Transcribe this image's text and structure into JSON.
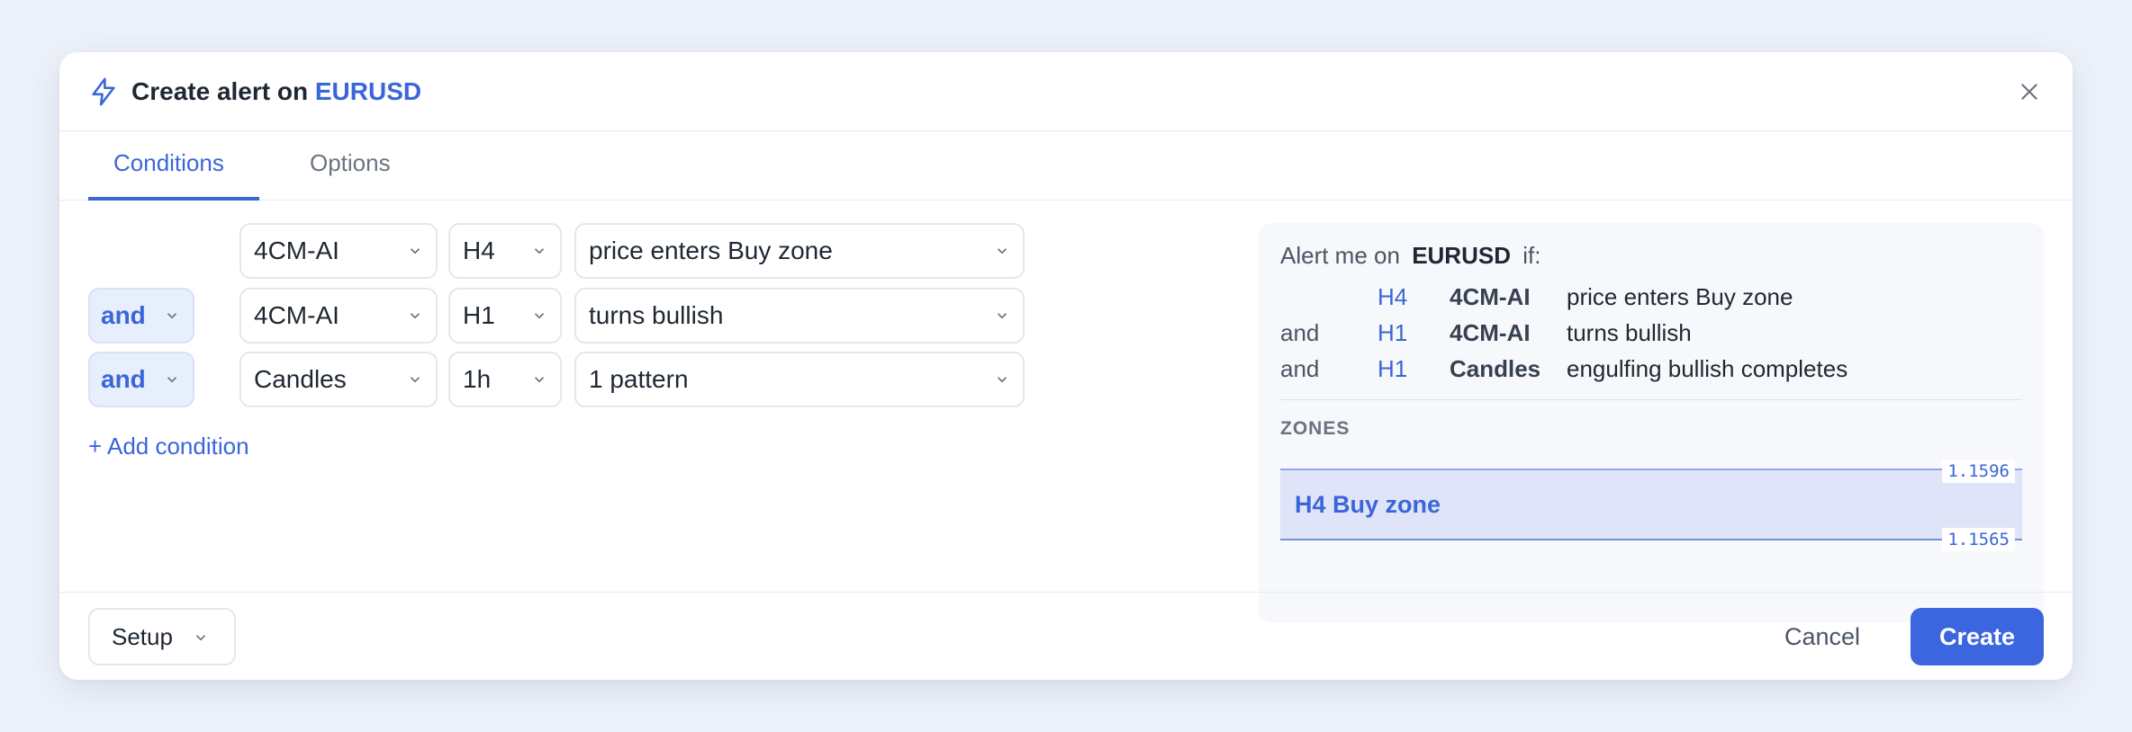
{
  "dialog": {
    "title_prefix": "Create alert on",
    "symbol": "EURUSD",
    "title_icon": "lightning-icon",
    "close_icon": "close-icon"
  },
  "tabs": [
    {
      "label": "Conditions",
      "active": true
    },
    {
      "label": "Options",
      "active": false
    }
  ],
  "conditions": [
    {
      "joiner": "",
      "indicator": "4CM-AI",
      "timeframe": "H4",
      "condition": "price enters Buy zone"
    },
    {
      "joiner": "and",
      "indicator": "4CM-AI",
      "timeframe": "H1",
      "condition": "turns bullish"
    },
    {
      "joiner": "and",
      "indicator": "Candles",
      "timeframe": "1h",
      "condition": "1 pattern"
    }
  ],
  "add_condition_label": "+ Add condition",
  "summary": {
    "prefix": "Alert me on",
    "symbol": "EURUSD",
    "suffix": "if:",
    "rows": [
      {
        "joiner": "",
        "timeframe": "H4",
        "indicator": "4CM-AI",
        "condition": "price enters Buy zone"
      },
      {
        "joiner": "and",
        "timeframe": "H1",
        "indicator": "4CM-AI",
        "condition": "turns bullish"
      },
      {
        "joiner": "and",
        "timeframe": "H1",
        "indicator": "Candles",
        "condition": "engulfing bullish completes"
      }
    ],
    "zones_label": "ZONES",
    "zone": {
      "name": "H4 Buy zone",
      "upper": "1.1596",
      "lower": "1.1565"
    }
  },
  "footer": {
    "setup_label": "Setup",
    "cancel_label": "Cancel",
    "create_label": "Create"
  },
  "colors": {
    "accent": "#3b66e0",
    "zone_fill": "#dfe4f8"
  }
}
